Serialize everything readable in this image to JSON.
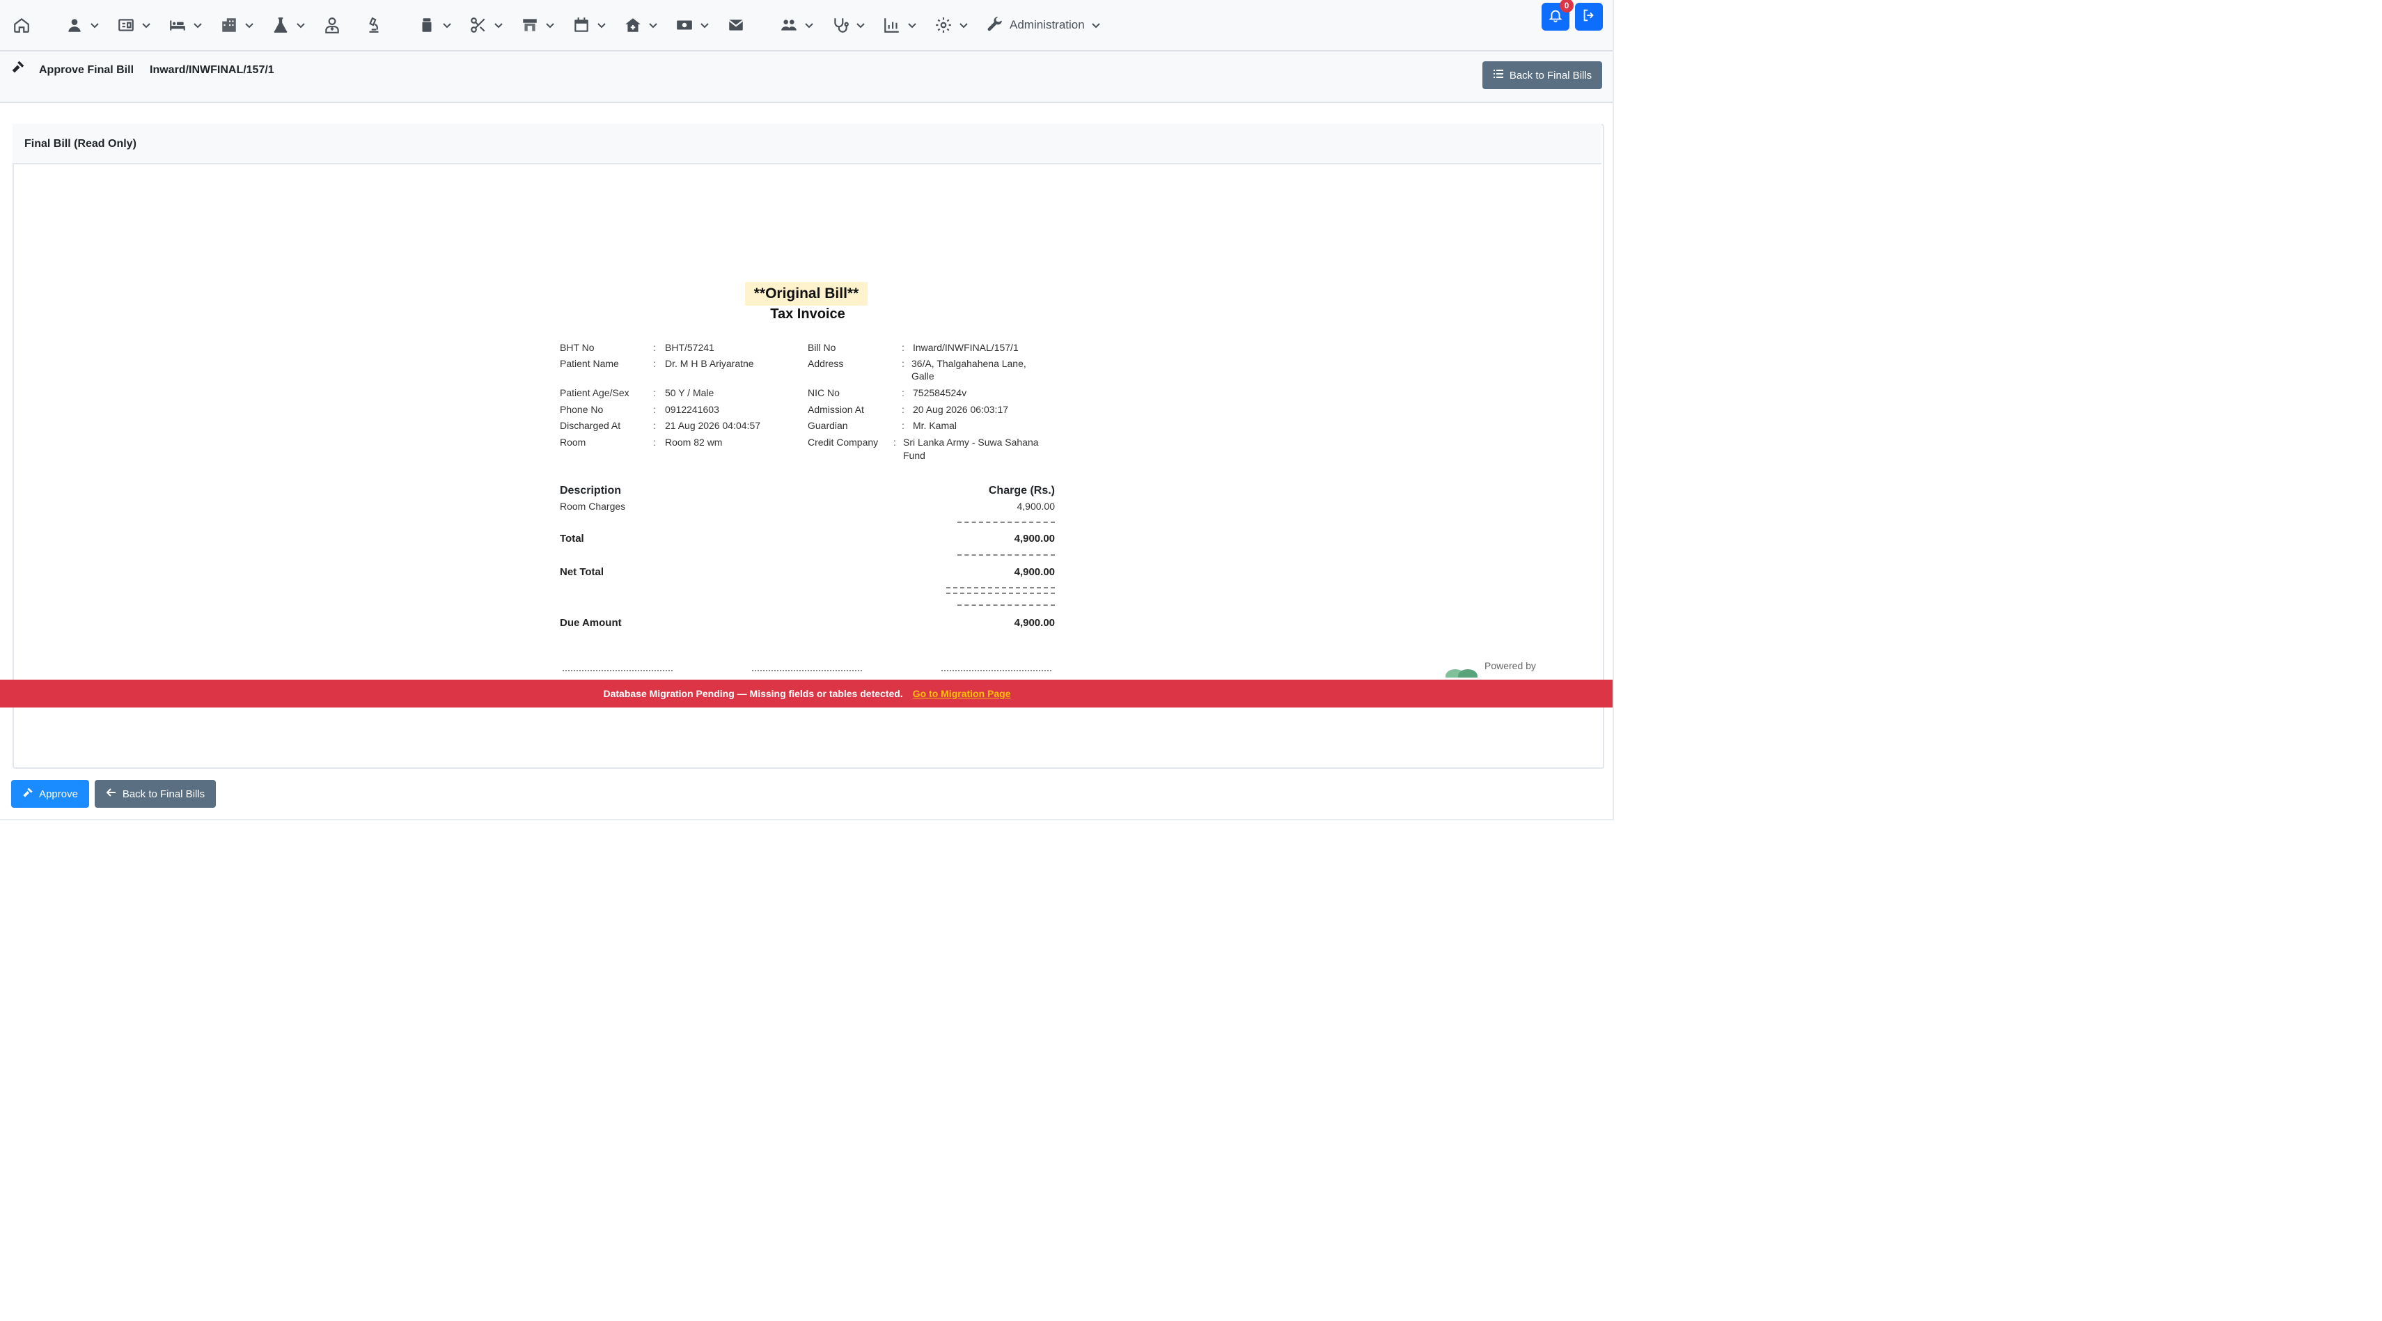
{
  "nav": {
    "admin_label": "Administration",
    "notification_count": "0"
  },
  "header": {
    "title": "Approve Final Bill",
    "bill_number": "Inward/INWFINAL/157/1",
    "back_button": "Back to Final Bills"
  },
  "card": {
    "title": "Final Bill (Read Only)"
  },
  "invoice": {
    "heading": "**Original Bill**",
    "subheading": "Tax Invoice",
    "left": [
      {
        "label": "BHT No",
        "value": "BHT/57241"
      },
      {
        "label": "Patient Name",
        "value": "Dr. M H B Ariyaratne"
      },
      {
        "label": "Patient Age/Sex",
        "value": "50 Y / Male"
      },
      {
        "label": "Phone No",
        "value": "0912241603"
      },
      {
        "label": "Discharged At",
        "value": "21 Aug 2026 04:04:57"
      },
      {
        "label": "Room",
        "value": "Room 82 wm"
      }
    ],
    "right": [
      {
        "label": "Bill No",
        "value": "Inward/INWFINAL/157/1"
      },
      {
        "label": "Address",
        "value": "36/A, Thalgahahena Lane,",
        "value2": "Galle"
      },
      {
        "label": "NIC No",
        "value": "752584524v"
      },
      {
        "label": "Admission At",
        "value": "20 Aug 2026 06:03:17"
      },
      {
        "label": "Guardian",
        "value": "Mr. Kamal"
      },
      {
        "label": "Credit Company",
        "value": "Sri Lanka Army - Suwa Sahana",
        "value2": "Fund"
      }
    ],
    "colon": ":",
    "desc_header": "Description",
    "charge_header": "Charge (Rs.)",
    "item_label": "Room Charges",
    "item_value": "4,900.00",
    "total_label": "Total",
    "total_value": "4,900.00",
    "net_total_label": "Net Total",
    "net_total_value": "4,900.00",
    "due_label": "Due Amount",
    "due_value": "4,900.00",
    "powered_by": "Powered by"
  },
  "banner": {
    "message": "Database Migration Pending — Missing fields or tables detected.",
    "link": "Go to Migration Page"
  },
  "actions": {
    "approve": "Approve",
    "back": "Back to Final Bills"
  },
  "colors": {
    "primary": "#1a8cff",
    "secondary": "#5a6f82",
    "danger": "#dc3545",
    "highlight": "#fff3cd"
  }
}
